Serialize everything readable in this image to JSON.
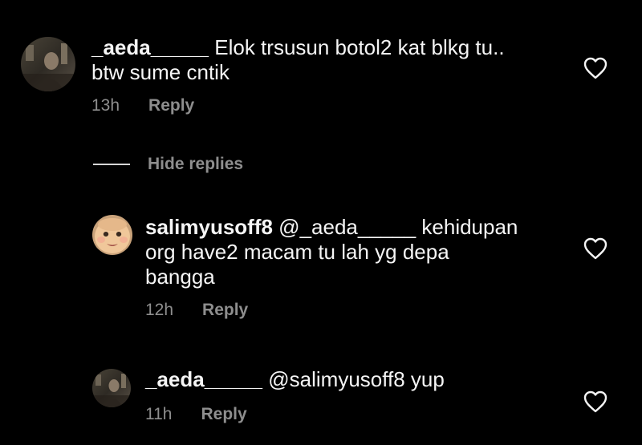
{
  "comments": [
    {
      "username": "_aeda_____",
      "text": " Elok trsusun botol2 kat blkg tu..",
      "text_line2": "btw sume cntik",
      "time": "13h",
      "reply_label": "Reply",
      "avatar_icon": "profile-photo"
    }
  ],
  "hide_replies_label": "Hide replies",
  "replies": [
    {
      "username": "salimyusoff8",
      "mention": " @_aeda_____",
      "text": " kehidupan",
      "text_line2": "org have2 macam tu lah yg depa",
      "text_line3": "bangga",
      "time": "12h",
      "reply_label": "Reply",
      "avatar_icon": "baby-face-avatar"
    },
    {
      "username": "_aeda_____",
      "mention": " @salimyusoff8",
      "text": " yup",
      "time": "11h",
      "reply_label": "Reply",
      "avatar_icon": "profile-photo"
    }
  ],
  "colors": {
    "background": "#000000",
    "text": "#f5f5f5",
    "muted": "#8e8e8e"
  },
  "icons": {
    "like": "heart-outline-icon"
  }
}
